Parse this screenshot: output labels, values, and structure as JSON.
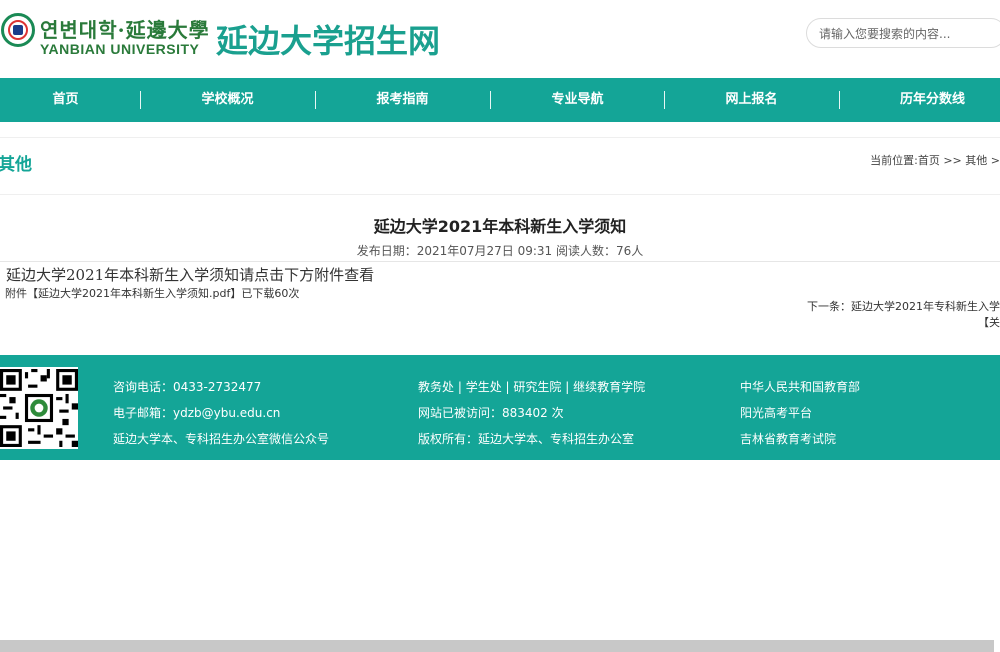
{
  "header": {
    "logo_korean": "연변대학·延邊大學",
    "logo_english": "YANBIAN UNIVERSITY",
    "site_title": "延边大学招生网",
    "search_placeholder": "请输入您要搜索的内容..."
  },
  "nav": {
    "items": [
      "首页",
      "学校概况",
      "报考指南",
      "专业导航",
      "网上报名",
      "历年分数线"
    ]
  },
  "section": {
    "title": "其他",
    "breadcrumb_prefix": "当前位置:",
    "breadcrumb_home": "首页",
    "breadcrumb_sep1": " >> ",
    "breadcrumb_current": "其他",
    "breadcrumb_sep2": " >"
  },
  "article": {
    "title": "延边大学2021年本科新生入学须知",
    "meta": "发布日期：2021年07月27日 09:31    阅读人数：76人",
    "body": "延边大学2021年本科新生入学须知请点击下方附件查看",
    "attachment_prefix": "附件【",
    "attachment_name": "延边大学2021年本科新生入学须知.pdf",
    "attachment_suffix": "】已下载60次",
    "next_label": "下一条：",
    "next_title": "延边大学2021年专科新生入学",
    "close_label": "【关"
  },
  "footer": {
    "col1": [
      "咨询电话：0433-2732477",
      "电子邮箱：ydzb@ybu.edu.cn",
      "延边大学本、专科招生办公室微信公众号"
    ],
    "col2_links": [
      "教务处",
      "学生处",
      "研究生院",
      "继续教育学院"
    ],
    "col2_sep": " | ",
    "col2": [
      "网站已被访问：883402 次",
      "版权所有：延边大学本、专科招生办公室"
    ],
    "col3": [
      "中华人民共和国教育部",
      "阳光高考平台",
      "吉林省教育考试院"
    ]
  },
  "colors": {
    "primary": "#14a597",
    "title_green": "#1aa08f",
    "logo_green": "#2a7a3a"
  },
  "icons": [
    "university-emblem-icon",
    "qr-code-icon"
  ]
}
